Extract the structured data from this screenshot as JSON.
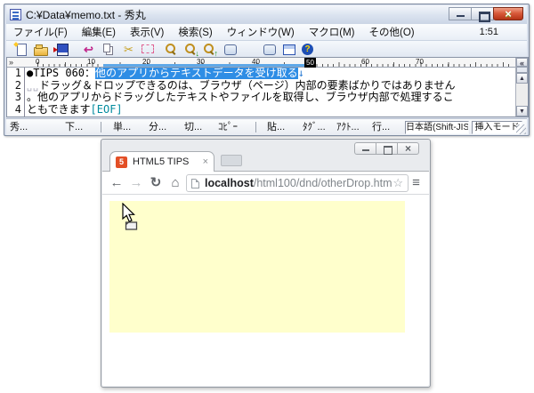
{
  "editor": {
    "title": "C:¥Data¥memo.txt - 秀丸",
    "clock": "1:51",
    "menus": [
      "ファイル(F)",
      "編集(E)",
      "表示(V)",
      "検索(S)",
      "ウィンドウ(W)",
      "マクロ(M)",
      "その他(O)"
    ],
    "toolbar_icons": [
      "new-file",
      "open-file",
      "save-file",
      "undo",
      "copy",
      "cut",
      "selection-mode",
      "search",
      "search-next",
      "search-prev",
      "window-list",
      "split-window",
      "help"
    ],
    "glyphs": {
      "undo": "↩",
      "cut": "✂",
      "find_down": "↓",
      "find_up": "↑",
      "help": "?",
      "ruler_left": "»",
      "ruler_right": "«",
      "scroll_up": "▲",
      "scroll_down": "▼"
    },
    "ruler": {
      "labels": [
        "0",
        "10",
        "20",
        "30",
        "40",
        "50",
        "60",
        "70"
      ]
    },
    "lines": [
      {
        "num": "1",
        "pre": "●TIPS 060：",
        "selected": "他のアプリからテキストデータを受け取る",
        "newline_mark": "↓"
      },
      {
        "num": "2",
        "space_marks": "␣␣",
        "text": "ドラッグ＆ドロップできるのは、ブラウザ（ページ）内部の要素ばかりではありません"
      },
      {
        "num": "3",
        "text": "。他のアプリからドラッグしたテキストやファイルを取得し、ブラウザ内部で処理するこ"
      },
      {
        "num": "4",
        "text": "ともできます",
        "eof_mark": "[EOF]"
      }
    ],
    "statusbar": {
      "buttons": [
        "秀...",
        "下...",
        "単...",
        "分...",
        "切...",
        "ｺﾋﾟｰ",
        "貼...",
        "ﾀｸﾞ...",
        "ｱｸﾄ...",
        "行..."
      ],
      "encoding": "日本語(Shift-JIS)",
      "input_mode": "挿入モード"
    }
  },
  "browser": {
    "tab": {
      "favicon_text": "5",
      "title": "HTML5 TIPS",
      "close_glyph": "×"
    },
    "nav": {
      "back": "←",
      "forward": "→",
      "reload": "↻",
      "home": "⌂",
      "bookmark_star": "☆",
      "menu": "≡"
    },
    "address": {
      "host": "localhost",
      "path": "/html100/dnd/otherDrop.htm"
    }
  },
  "colors": {
    "selection_bg": "#2E8DE5",
    "eof_mark": "#008B9E",
    "drop_zone": "#FFFFCC",
    "html5_orange": "#E34F26",
    "close_button_red": "#B53317"
  }
}
